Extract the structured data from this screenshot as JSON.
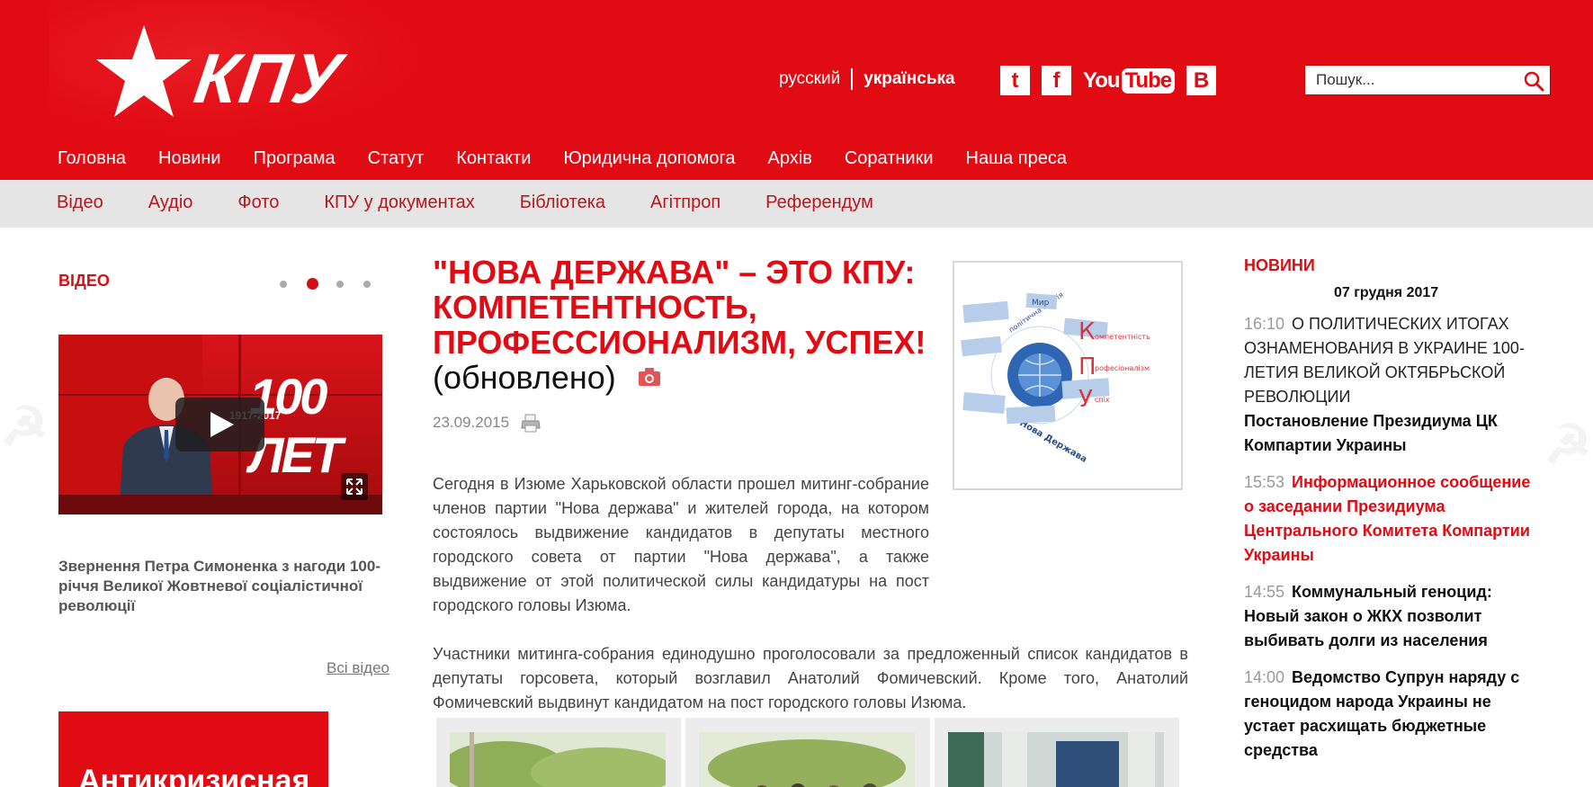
{
  "header": {
    "logo_text": "КПУ",
    "languages": [
      {
        "label": "русский",
        "active": false
      },
      {
        "label": "українська",
        "active": true
      }
    ],
    "social": {
      "twitter": "t",
      "facebook": "f",
      "youtube_you": "You",
      "youtube_tube": "Tube",
      "vk": "B"
    },
    "search": {
      "placeholder": "Пошук..."
    }
  },
  "main_nav": [
    "Головна",
    "Новини",
    "Програма",
    "Статут",
    "Контакти",
    "Юридична допомога",
    "Архів",
    "Соратники",
    "Наша преса"
  ],
  "sub_nav": [
    "Відео",
    "Аудіо",
    "Фото",
    "КПУ у документах",
    "Бібліотека",
    "Агітпроп",
    "Референдум"
  ],
  "video_section": {
    "title": "ВІДЕО",
    "slides": 4,
    "active_slide": 2,
    "thumbnail_text": "100 ЛЕТ",
    "thumbnail_years": "1917-2017",
    "caption": "Звернення Петра Симоненка з нагоди 100-річчя Великої Жовтневої соціалістичної революції",
    "all_link": "Всі відео",
    "banner_text": "Антикризисная"
  },
  "article": {
    "title": "\"НОВА ДЕРЖАВА\" – ЭТО КПУ: КОМПЕТЕНТНОСТЬ, ПРОФЕССИОНАЛИЗМ, УСПЕХ!",
    "title_suffix": "(обновлено)",
    "date": "23.09.2015",
    "paragraphs": [
      "Сегодня в Изюме Харьковской области прошел митинг-собрание членов партии \"Нова держава\" и жителей города, на котором состоялось выдвижение кандидатов в депутаты местного городского совета от партии \"Нова держава\", а также выдвижение от этой политической силы кандидатуры на пост городского головы Изюма.",
      "Участники митинга-собрания единодушно проголосовали за предложенный список кандидатов в депутаты горсовета, который возглавил Анатолий Фомичевский. Кроме того, Анатолий Фомичевский выдвинут кандидатом на пост городского головы Изюма."
    ],
    "image_labels": {
      "center_top": "політична партія",
      "center_bottom": "Нова Держава",
      "k": "К",
      "k_rest": "омпетентність",
      "p": "П",
      "p_rest": "рофесіоналізм",
      "u": "У",
      "u_rest": "спіх",
      "box_mir": "Мир"
    }
  },
  "news": {
    "title": "НОВИНИ",
    "date": "07 грудня 2017",
    "items": [
      {
        "time": "16:10",
        "text": "О ПОЛИТИЧЕСКИХ ИТОГАХ ОЗНАМЕНОВАНИЯ В УКРАИНЕ 100-ЛЕТИЯ ВЕЛИКОЙ ОКТЯБРЬСКОЙ РЕВОЛЮЦИИ",
        "subtext": "Постановление Президиума ЦК Компартии Украины"
      },
      {
        "time": "15:53",
        "text": "Информационное сообщение о заседании Президиума Центрального Комитета Компартии Украины"
      },
      {
        "time": "14:55",
        "text": "Коммунальный геноцид: Новый закон о ЖКХ позволит выбивать долги из населения"
      },
      {
        "time": "14:00",
        "text": "Ведомство Супрун наряду с геноцидом народа Украины не устает расхищать бюджетные средства"
      }
    ]
  },
  "colors": {
    "brand_red": "#e10b14",
    "subnav_bg": "#e5e5e5",
    "subnav_text": "#b5171c"
  }
}
